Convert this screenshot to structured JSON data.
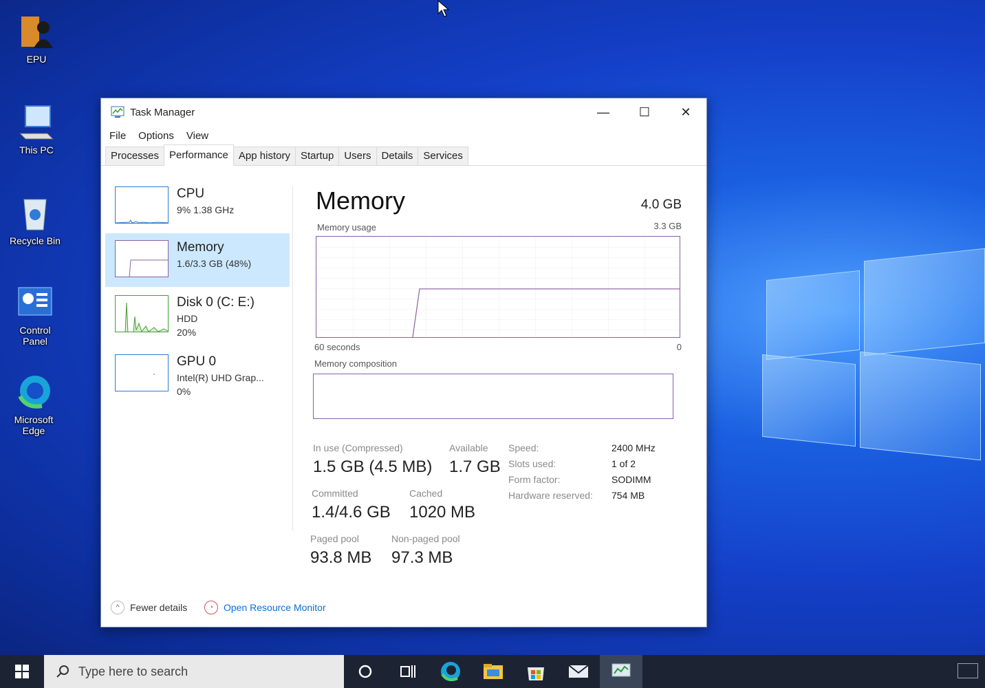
{
  "desktop": {
    "icons": [
      {
        "label": "EPU",
        "icon": "user-folder-icon"
      },
      {
        "label": "This PC",
        "icon": "computer-icon"
      },
      {
        "label": "Recycle Bin",
        "icon": "recycle-bin-icon"
      },
      {
        "label": "Control Panel",
        "icon": "control-panel-icon"
      },
      {
        "label": "Microsoft Edge",
        "icon": "edge-icon"
      }
    ]
  },
  "window": {
    "title": "Task Manager",
    "controls": {
      "minimize": "—",
      "maximize": "☐",
      "close": "✕"
    }
  },
  "menu": [
    "File",
    "Options",
    "View"
  ],
  "tabs": [
    "Processes",
    "Performance",
    "App history",
    "Startup",
    "Users",
    "Details",
    "Services"
  ],
  "active_tab": "Performance",
  "sidebar": {
    "items": [
      {
        "name": "CPU",
        "sub1": "9%  1.38 GHz",
        "sub2": ""
      },
      {
        "name": "Memory",
        "sub1": "1.6/3.3 GB (48%)",
        "sub2": ""
      },
      {
        "name": "Disk 0 (C: E:)",
        "sub1": "HDD",
        "sub2": "20%"
      },
      {
        "name": "GPU 0",
        "sub1": "Intel(R) UHD Grap...",
        "sub2": "0%"
      }
    ],
    "selected_index": 1
  },
  "memory": {
    "title": "Memory",
    "total": "4.0 GB",
    "usage_label": "Memory usage",
    "usage_max": "3.3 GB",
    "time_left": "60 seconds",
    "time_right": "0",
    "composition_label": "Memory composition",
    "usage_fraction": 0.48,
    "stats": {
      "in_use_label": "In use (Compressed)",
      "in_use_value": "1.5 GB (4.5 MB)",
      "available_label": "Available",
      "available_value": "1.7 GB",
      "committed_label": "Committed",
      "committed_value": "1.4/4.6 GB",
      "cached_label": "Cached",
      "cached_value": "1020 MB",
      "paged_label": "Paged pool",
      "paged_value": "93.8 MB",
      "nonpaged_label": "Non-paged pool",
      "nonpaged_value": "97.3 MB"
    },
    "details": [
      {
        "label": "Speed:",
        "value": "2400 MHz"
      },
      {
        "label": "Slots used:",
        "value": "1 of 2"
      },
      {
        "label": "Form factor:",
        "value": "SODIMM"
      },
      {
        "label": "Hardware reserved:",
        "value": "754 MB"
      }
    ]
  },
  "footer": {
    "fewer_details": "Fewer details",
    "resource_monitor": "Open Resource Monitor"
  },
  "taskbar": {
    "search_placeholder": "Type here to search"
  },
  "colors": {
    "accent_graph": "#8b5fa5",
    "selected_bg": "#cce8ff",
    "link": "#0a6fd6"
  }
}
